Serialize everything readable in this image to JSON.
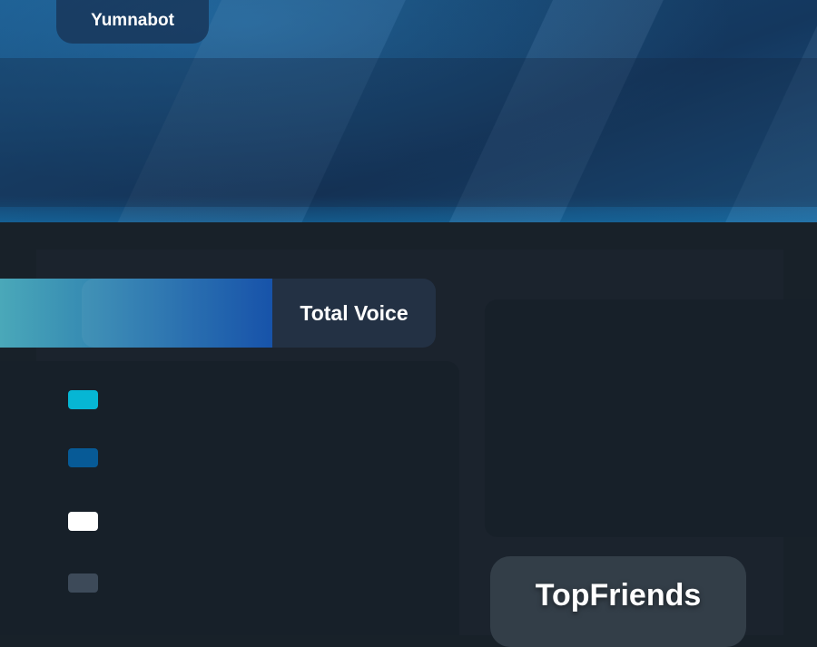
{
  "header": {
    "brand": "Yumnabot"
  },
  "voice": {
    "label": "Total Voice"
  },
  "legend": {
    "swatches": [
      {
        "color": "#06b6d4"
      },
      {
        "color": "#075a96"
      },
      {
        "color": "#ffffff"
      },
      {
        "color": "#3d4a59"
      }
    ]
  },
  "friends": {
    "title": "TopFriends"
  }
}
